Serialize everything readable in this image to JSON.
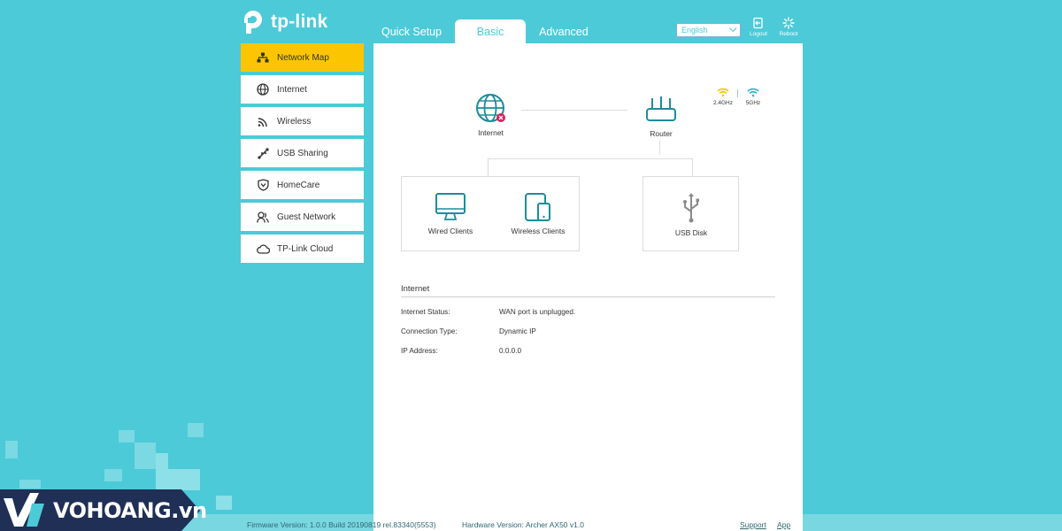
{
  "brand": {
    "name": "tp-link"
  },
  "tabs": [
    {
      "label": "Quick Setup",
      "active": false
    },
    {
      "label": "Basic",
      "active": true
    },
    {
      "label": "Advanced",
      "active": false
    }
  ],
  "language": {
    "selected": "English"
  },
  "top_buttons": {
    "logout": "Logout",
    "reboot": "Reboot"
  },
  "sidebar": {
    "items": [
      {
        "label": "Network Map",
        "icon": "network-map-icon",
        "active": true
      },
      {
        "label": "Internet",
        "icon": "globe-icon",
        "active": false
      },
      {
        "label": "Wireless",
        "icon": "wifi-icon",
        "active": false
      },
      {
        "label": "USB Sharing",
        "icon": "usb-icon",
        "active": false
      },
      {
        "label": "HomeCare",
        "icon": "shield-icon",
        "active": false
      },
      {
        "label": "Guest Network",
        "icon": "guest-icon",
        "active": false
      },
      {
        "label": "TP-Link Cloud",
        "icon": "cloud-icon",
        "active": false
      }
    ]
  },
  "map": {
    "internet": "Internet",
    "router": "Router",
    "band_24": "2.4GHz",
    "band_5": "5GHz",
    "wired_clients": "Wired Clients",
    "wireless_clients": "Wireless Clients",
    "usb_disk": "USB Disk"
  },
  "internet_info": {
    "title": "Internet",
    "rows": [
      {
        "label": "Internet Status:",
        "value": "WAN port is unplugged."
      },
      {
        "label": "Connection Type:",
        "value": "Dynamic IP"
      },
      {
        "label": "IP Address:",
        "value": "0.0.0.0"
      }
    ]
  },
  "footer": {
    "firmware": "Firmware Version: 1.0.0 Build 20190819 rel.83340(5553)",
    "hardware": "Hardware Version: Archer AX50 v1.0",
    "support": "Support",
    "app": "App"
  },
  "watermark": {
    "text": "VOHOANG.vn"
  },
  "colors": {
    "background": "#4ccad8",
    "accent": "#4ccad8",
    "active_sidebar": "#fbc601",
    "icon": "#1b8d9d",
    "error": "#d81e5b",
    "band_24": "#f5c400",
    "band_5": "#2bb3d1"
  }
}
